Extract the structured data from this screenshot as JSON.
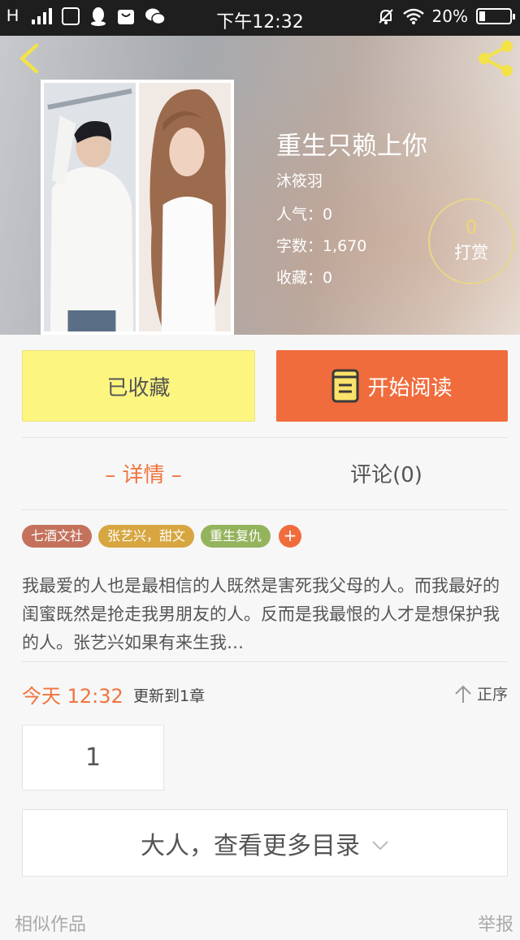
{
  "status_bar": {
    "signal_label": "H",
    "time": "下午12:32",
    "battery_text": "20%",
    "battery_level": 0.2,
    "icons": [
      "signal-icon",
      "sim-icon",
      "qq-icon",
      "bag-icon",
      "wechat-icon",
      "mute-icon",
      "wifi-icon",
      "battery-icon"
    ]
  },
  "header": {
    "back_icon": "chevron-left-icon",
    "share_icon": "share-icon"
  },
  "book": {
    "title": "重生只赖上你",
    "author": "沐筱羽",
    "popularity": "人气：0",
    "word_count": "字数：1,670",
    "favorites": "收藏：0"
  },
  "reward": {
    "count": "0",
    "label": "打赏"
  },
  "actions": {
    "collect_label": "已收藏",
    "read_label": "开始阅读",
    "colors": {
      "collect_bg": "#fcf681",
      "read_bg": "#f06c3c"
    }
  },
  "tabs": [
    {
      "label": "– 详情 –",
      "active": true
    },
    {
      "label": "评论(0)",
      "active": false
    }
  ],
  "tags": [
    {
      "label": "七酒文社",
      "color": "#c4725d"
    },
    {
      "label": "张艺兴，甜文",
      "color": "#d7a640"
    },
    {
      "label": "重生复仇",
      "color": "#94b35d"
    }
  ],
  "tag_add_label": "+",
  "synopsis": "我最爱的人也是最相信的人既然是害死我父母的人。而我最好的闺蜜既然是抢走我男朋友的人。反而是我最恨的人才是想保护我的人。张艺兴如果有来生我…",
  "update": {
    "time": "今天 12:32",
    "text": "更新到1章",
    "sort_label": "正序"
  },
  "chapters": [
    "1"
  ],
  "more_catalog_label": "大人，查看更多目录",
  "footer": {
    "similar_label": "相似作品",
    "report_label": "举报"
  }
}
